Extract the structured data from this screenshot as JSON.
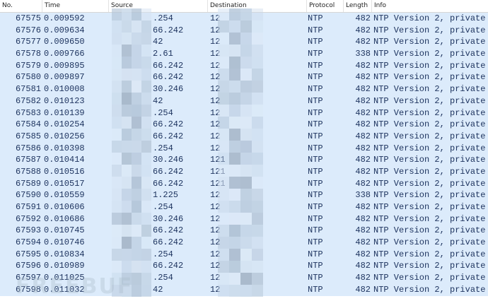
{
  "columns": {
    "no": "No.",
    "time": "Time",
    "source": "Source",
    "destination": "Destination",
    "protocol": "Protocol",
    "length": "Length",
    "info": "Info"
  },
  "colors": {
    "row_background": "#dcebfb",
    "text": "#1f3560",
    "header_background": "#ffffff"
  },
  "rows": [
    {
      "no": "67575",
      "time": "0.009592",
      "source": ".254",
      "destination": "12",
      "protocol": "NTP",
      "length": "482",
      "info": "NTP Version 2, private"
    },
    {
      "no": "67576",
      "time": "0.009634",
      "source": "66.242",
      "destination": "12",
      "protocol": "NTP",
      "length": "482",
      "info": "NTP Version 2, private"
    },
    {
      "no": "67577",
      "time": "0.009650",
      "source": "42",
      "destination": "12",
      "protocol": "NTP",
      "length": "482",
      "info": "NTP Version 2, private"
    },
    {
      "no": "67578",
      "time": "0.009766",
      "source": "2.61",
      "destination": "12",
      "protocol": "NTP",
      "length": "338",
      "info": "NTP Version 2, private"
    },
    {
      "no": "67579",
      "time": "0.009895",
      "source": "66.242",
      "destination": "12",
      "protocol": "NTP",
      "length": "482",
      "info": "NTP Version 2, private"
    },
    {
      "no": "67580",
      "time": "0.009897",
      "source": "66.242",
      "destination": "12",
      "protocol": "NTP",
      "length": "482",
      "info": "NTP Version 2, private"
    },
    {
      "no": "67581",
      "time": "0.010008",
      "source": "30.246",
      "destination": "12",
      "protocol": "NTP",
      "length": "482",
      "info": "NTP Version 2, private"
    },
    {
      "no": "67582",
      "time": "0.010123",
      "source": "42",
      "destination": "12",
      "protocol": "NTP",
      "length": "482",
      "info": "NTP Version 2, private"
    },
    {
      "no": "67583",
      "time": "0.010139",
      "source": ".254",
      "destination": "12",
      "protocol": "NTP",
      "length": "482",
      "info": "NTP Version 2, private"
    },
    {
      "no": "67584",
      "time": "0.010254",
      "source": "66.242",
      "destination": "12",
      "protocol": "NTP",
      "length": "482",
      "info": "NTP Version 2, private"
    },
    {
      "no": "67585",
      "time": "0.010256",
      "source": "66.242",
      "destination": "12",
      "protocol": "NTP",
      "length": "482",
      "info": "NTP Version 2, private"
    },
    {
      "no": "67586",
      "time": "0.010398",
      "source": ".254",
      "destination": "12",
      "protocol": "NTP",
      "length": "482",
      "info": "NTP Version 2, private"
    },
    {
      "no": "67587",
      "time": "0.010414",
      "source": "30.246",
      "destination": "121",
      "protocol": "NTP",
      "length": "482",
      "info": "NTP Version 2, private"
    },
    {
      "no": "67588",
      "time": "0.010516",
      "source": "66.242",
      "destination": "121",
      "protocol": "NTP",
      "length": "482",
      "info": "NTP Version 2, private"
    },
    {
      "no": "67589",
      "time": "0.010517",
      "source": "66.242",
      "destination": "121",
      "protocol": "NTP",
      "length": "482",
      "info": "NTP Version 2, private"
    },
    {
      "no": "67590",
      "time": "0.010559",
      "source": "1.225",
      "destination": "12",
      "protocol": "NTP",
      "length": "338",
      "info": "NTP Version 2, private"
    },
    {
      "no": "67591",
      "time": "0.010606",
      "source": ".254",
      "destination": "12",
      "protocol": "NTP",
      "length": "482",
      "info": "NTP Version 2, private"
    },
    {
      "no": "67592",
      "time": "0.010686",
      "source": "30.246",
      "destination": "12",
      "protocol": "NTP",
      "length": "482",
      "info": "NTP Version 2, private"
    },
    {
      "no": "67593",
      "time": "0.010745",
      "source": "66.242",
      "destination": "12",
      "protocol": "NTP",
      "length": "482",
      "info": "NTP Version 2, private"
    },
    {
      "no": "67594",
      "time": "0.010746",
      "source": "66.242",
      "destination": "12",
      "protocol": "NTP",
      "length": "482",
      "info": "NTP Version 2, private"
    },
    {
      "no": "67595",
      "time": "0.010834",
      "source": ".254",
      "destination": "12",
      "protocol": "NTP",
      "length": "482",
      "info": "NTP Version 2, private"
    },
    {
      "no": "67596",
      "time": "0.010989",
      "source": "66.242",
      "destination": "12",
      "protocol": "NTP",
      "length": "482",
      "info": "NTP Version 2, private"
    },
    {
      "no": "67597",
      "time": "0.011025",
      "source": ".254",
      "destination": "12",
      "protocol": "NTP",
      "length": "482",
      "info": "NTP Version 2, private"
    },
    {
      "no": "67598",
      "time": "0.011032",
      "source": "42",
      "destination": "12",
      "protocol": "NTP",
      "length": "482",
      "info": "NTP Version 2, private"
    }
  ],
  "watermark": "FREEBUF"
}
